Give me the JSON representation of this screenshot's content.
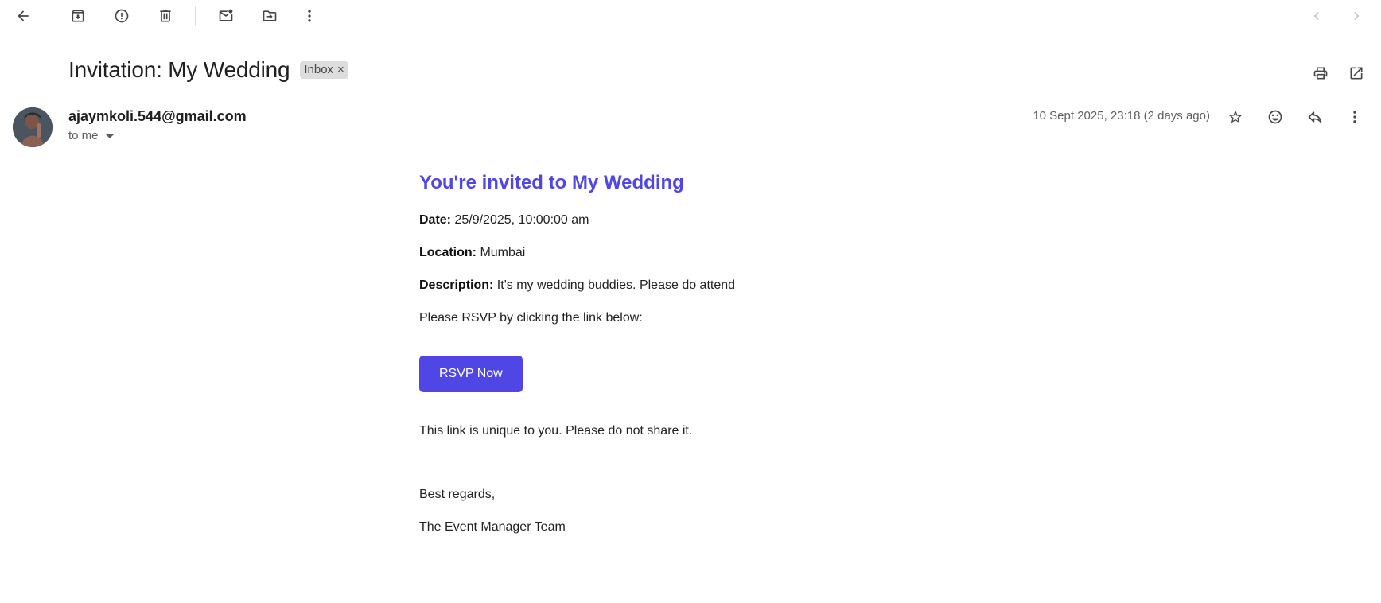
{
  "toolbar": {
    "icons": [
      "back-arrow-icon",
      "archive-icon",
      "report-spam-icon",
      "delete-icon",
      "mark-unread-icon",
      "move-to-icon",
      "more-vert-icon",
      "newer-icon",
      "older-icon"
    ]
  },
  "email": {
    "subject": "Invitation: My Wedding",
    "label": "Inbox",
    "label_remove": "×",
    "sender": "ajaymkoli.544@gmail.com",
    "recipient": "to me",
    "timestamp": "10 Sept 2025, 23:18 (2 days ago)"
  },
  "body": {
    "heading": "You're invited to My Wedding",
    "date_label": "Date:",
    "date_value": "25/9/2025, 10:00:00 am",
    "location_label": "Location:",
    "location_value": "Mumbai",
    "description_label": "Description:",
    "description_value": "It's my wedding buddies. Please do attend",
    "rsvp_prompt": "Please RSVP by clicking the link below:",
    "rsvp_button": "RSVP Now",
    "note": "This link is unique to you. Please do not share it.",
    "regards": "Best regards,",
    "signature": "The Event Manager Team"
  },
  "colors": {
    "accent": "#4f46e5",
    "chip_bg": "#dddddd"
  }
}
